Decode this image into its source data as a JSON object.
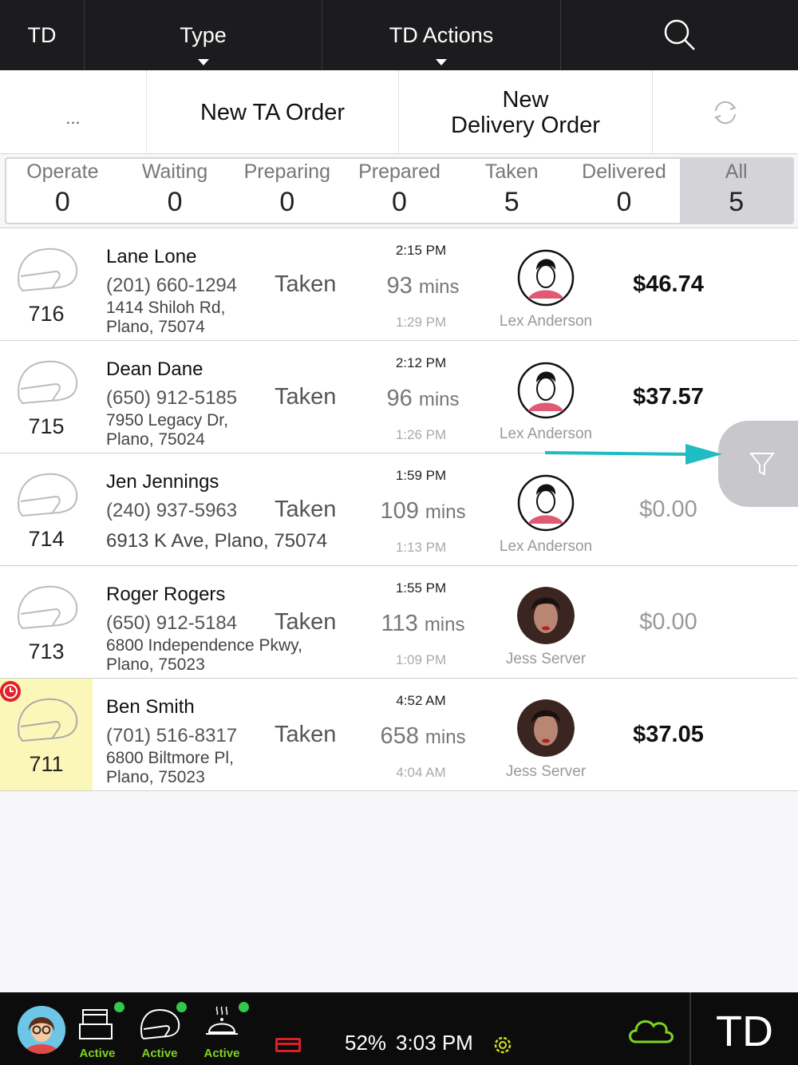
{
  "topbar": {
    "td": "TD",
    "type": "Type",
    "actions": "TD Actions",
    "search_icon": "search-icon"
  },
  "actionbar": {
    "more": "...",
    "new_ta": "New TA Order",
    "new_delivery_line1": "New",
    "new_delivery_line2": "Delivery Order",
    "refresh_icon": "refresh-icon"
  },
  "statuses": [
    {
      "label": "Operate",
      "count": "0"
    },
    {
      "label": "Waiting",
      "count": "0"
    },
    {
      "label": "Preparing",
      "count": "0"
    },
    {
      "label": "Prepared",
      "count": "0"
    },
    {
      "label": "Taken",
      "count": "5"
    },
    {
      "label": "Delivered",
      "count": "0"
    },
    {
      "label": "All",
      "count": "5"
    }
  ],
  "orders": [
    {
      "num": "716",
      "name": "Lane Lone",
      "phone": "(201) 660-1294",
      "addr1": "1414 Shiloh Rd,",
      "addr2": "Plano, 75074",
      "status": "Taken",
      "time1": "2:15 PM",
      "mins": "93",
      "mins_unit": "mins",
      "time2": "1:29 PM",
      "server": "Lex Anderson",
      "total": "$46.74"
    },
    {
      "num": "715",
      "name": "Dean Dane",
      "phone": "(650) 912-5185",
      "addr1": "7950 Legacy Dr,",
      "addr2": "Plano, 75024",
      "status": "Taken",
      "time1": "2:12 PM",
      "mins": "96",
      "mins_unit": "mins",
      "time2": "1:26 PM",
      "server": "Lex Anderson",
      "total": "$37.57"
    },
    {
      "num": "714",
      "name": "Jen Jennings",
      "phone": "(240) 937-5963",
      "addr1": "6913 K Ave, Plano, 75074",
      "addr2": "",
      "status": "Taken",
      "time1": "1:59 PM",
      "mins": "109",
      "mins_unit": "mins",
      "time2": "1:13 PM",
      "server": "Lex Anderson",
      "total": "$0.00"
    },
    {
      "num": "713",
      "name": "Roger Rogers",
      "phone": "(650) 912-5184",
      "addr1": "6800 Independence Pkwy,",
      "addr2": "Plano, 75023",
      "status": "Taken",
      "time1": "1:55 PM",
      "mins": "113",
      "mins_unit": "mins",
      "time2": "1:09 PM",
      "server": "Jess Server",
      "total": "$0.00"
    },
    {
      "num": "711",
      "name": "Ben Smith",
      "phone": "(701) 516-8317",
      "addr1": "6800 Biltmore Pl,",
      "addr2": "Plano, 75023",
      "status": "Taken",
      "time1": "4:52 AM",
      "mins": "658",
      "mins_unit": "mins",
      "time2": "4:04 AM",
      "server": "Jess Server",
      "total": "$37.05"
    }
  ],
  "footer": {
    "active1": "Active",
    "active2": "Active",
    "active3": "Active",
    "battery": "52%",
    "time": "3:03 PM",
    "td": "TD"
  },
  "colors": {
    "accent_arrow": "#1fbcc4",
    "late_row": "#fbf7b9",
    "alert": "#e2222a",
    "active_green": "#7ed321"
  }
}
